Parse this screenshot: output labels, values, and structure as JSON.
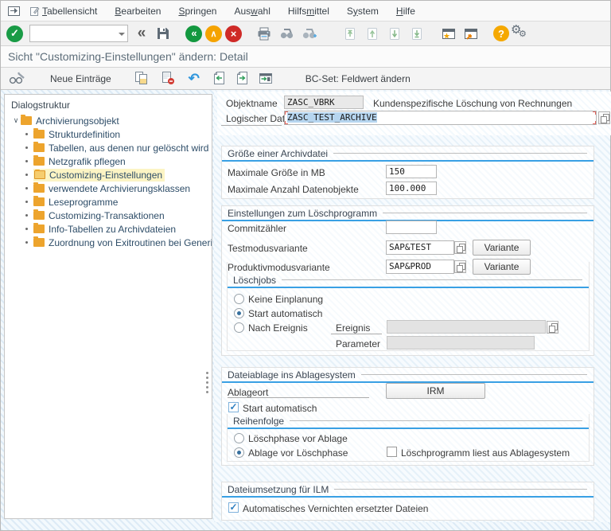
{
  "icons": {
    "enter": "✓",
    "back": "«",
    "exit": "∧",
    "cancel": "×",
    "help": "?",
    "settings": "⚙",
    "undo": "↶",
    "chevrons": "«",
    "expander": "∨"
  },
  "menu": {
    "items": [
      {
        "pre": "",
        "accel": "T",
        "post": "abellensicht"
      },
      {
        "pre": "",
        "accel": "B",
        "post": "earbeiten"
      },
      {
        "pre": "",
        "accel": "S",
        "post": "pringen"
      },
      {
        "pre": "Aus",
        "accel": "w",
        "post": "ahl"
      },
      {
        "pre": "Hilfs",
        "accel": "m",
        "post": "ittel"
      },
      {
        "pre": "S",
        "accel": "y",
        "post": "stem"
      },
      {
        "pre": "",
        "accel": "H",
        "post": "ilfe"
      }
    ]
  },
  "toolbar": {
    "command_value": ""
  },
  "titlebar": {
    "title": "Sicht \"Customizing-Einstellungen\" ändern: Detail"
  },
  "app_toolbar": {
    "new_entries": "Neue Einträge",
    "bc_set": "BC-Set: Feldwert ändern"
  },
  "tree": {
    "header": "Dialogstruktur",
    "root": "Archivierungsobjekt",
    "items": [
      "Strukturdefinition",
      "Tabellen, aus denen nur gelöscht wird",
      "Netzgrafik pflegen",
      "Customizing-Einstellungen",
      "verwendete Archivierungsklassen",
      "Leseprogramme",
      "Customizing-Transaktionen",
      "Info-Tabellen zu Archivdateien",
      "Zuordnung von Exitroutinen bei Generierung"
    ],
    "selected": "Customizing-Einstellungen"
  },
  "form": {
    "objektname": {
      "label": "Objektname",
      "value": "ZASC_VBRK",
      "desc": "Kundenspezifische Löschung von Rechnungen"
    },
    "log_dateiname": {
      "label": "Logischer Dateiname",
      "value": "ZASC_TEST_ARCHIVE"
    },
    "groesse": {
      "title": "Größe einer Archivdatei",
      "max_mb": {
        "label": "Maximale Größe in MB",
        "value": "150"
      },
      "max_obj": {
        "label": "Maximale Anzahl Datenobjekte",
        "value": "100.000"
      }
    },
    "loeschprogramm": {
      "title": "Einstellungen zum Löschprogramm",
      "commit": {
        "label": "Commitzähler",
        "value": ""
      },
      "testvar": {
        "label": "Testmodusvariante",
        "value": "SAP&TEST",
        "button": "Variante"
      },
      "prodvar": {
        "label": "Produktivmodusvariante",
        "value": "SAP&PROD",
        "button": "Variante"
      },
      "loeschjobs": {
        "title": "Löschjobs",
        "radio_none": "Keine Einplanung",
        "radio_auto": "Start automatisch",
        "radio_event": "Nach Ereignis",
        "ereignis": {
          "label": "Ereignis",
          "value": ""
        },
        "parameter": {
          "label": "Parameter",
          "value": ""
        }
      }
    },
    "ablage": {
      "title": "Dateiablage ins Ablagesystem",
      "ablageort_label": "Ablageort",
      "ablageort_button": "IRM",
      "start_auto": "Start automatisch",
      "reihenfolge": {
        "title": "Reihenfolge",
        "radio_loesch_first": "Löschphase vor Ablage",
        "radio_ablage_first": "Ablage vor Löschphase",
        "checkbox_read": "Löschprogramm liest aus Ablagesystem"
      }
    },
    "ilm": {
      "title": "Dateiumsetzung für ILM",
      "checkbox_destroy": "Automatisches Vernichten ersetzter Dateien"
    }
  },
  "colors": {
    "accent_blue": "#39a0e4",
    "selection_yellow": "#fcf4c4",
    "folder_orange": "#eda42d"
  }
}
